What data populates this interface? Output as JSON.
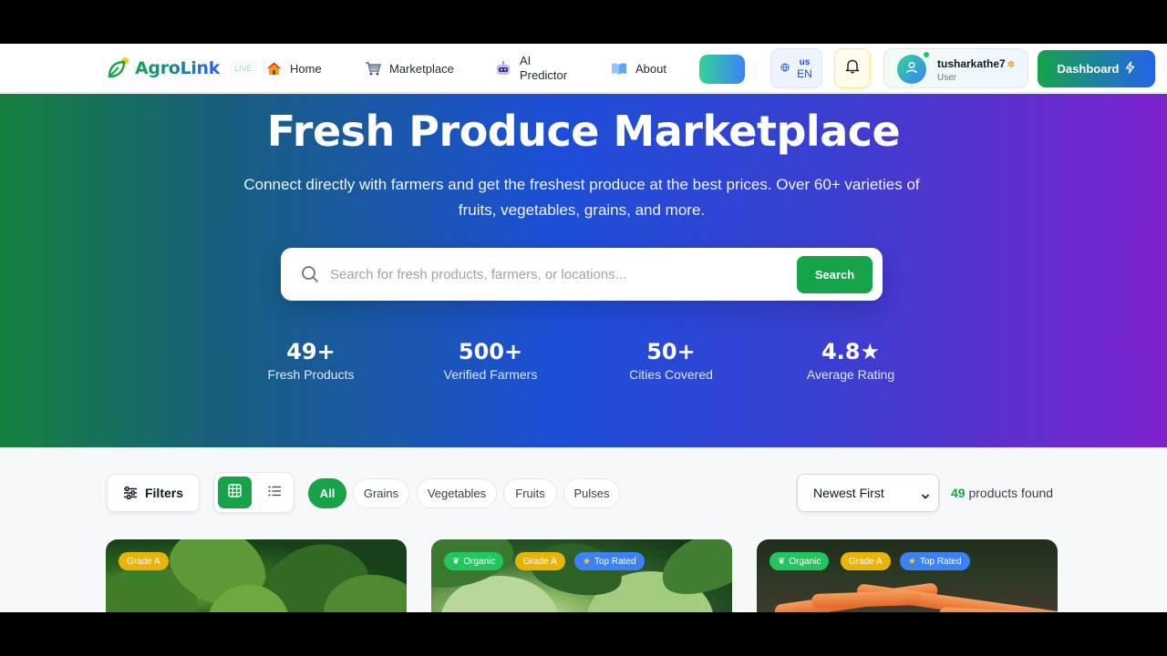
{
  "brand": {
    "name": "AgroLink",
    "live_label": "LIVE"
  },
  "nav": {
    "home": "Home",
    "marketplace": "Marketplace",
    "ai_line1": "AI",
    "ai_line2": "Predictor",
    "about": "About"
  },
  "language": {
    "region": "us",
    "code": "EN"
  },
  "user": {
    "name": "tusharkathe7",
    "role": "User"
  },
  "dashboard_label": "Dashboard",
  "hero": {
    "title": "Fresh Produce Marketplace",
    "subtitle": "Connect directly with farmers and get the freshest produce at the best prices. Over 60+ varieties of fruits, vegetables, grains, and more."
  },
  "search": {
    "placeholder": "Search for fresh products, farmers, or locations...",
    "value": "",
    "button": "Search"
  },
  "stats": [
    {
      "value": "49+",
      "label": "Fresh Products"
    },
    {
      "value": "500+",
      "label": "Verified Farmers"
    },
    {
      "value": "50+",
      "label": "Cities Covered"
    },
    {
      "value": "4.8★",
      "label": "Average Rating"
    }
  ],
  "toolbar": {
    "filters_label": "Filters",
    "categories": [
      "All",
      "Grains",
      "Vegetables",
      "Fruits",
      "Pulses"
    ],
    "active_category": "All",
    "sort_value": "Newest First",
    "count_number": "49",
    "count_suffix": "products found"
  },
  "cards": [
    {
      "badges": [
        "Grade A"
      ],
      "image": "spinach"
    },
    {
      "badges": [
        "Organic",
        "Grade A",
        "Top Rated"
      ],
      "image": "cabbage"
    },
    {
      "badges": [
        "Organic",
        "Grade A",
        "Top Rated"
      ],
      "image": "carrots"
    }
  ],
  "colors": {
    "primary_green": "#16a34a",
    "accent_blue": "#2563eb",
    "accent_purple": "#7e22ce",
    "badge_yellow": "#eab308",
    "badge_blue": "#3b82f6"
  },
  "icons": {
    "home": "house-icon",
    "marketplace": "cart-icon",
    "ai": "robot-icon",
    "about": "book-icon",
    "bell": "bell-icon",
    "bolt": "bolt-icon",
    "search": "search-icon"
  }
}
